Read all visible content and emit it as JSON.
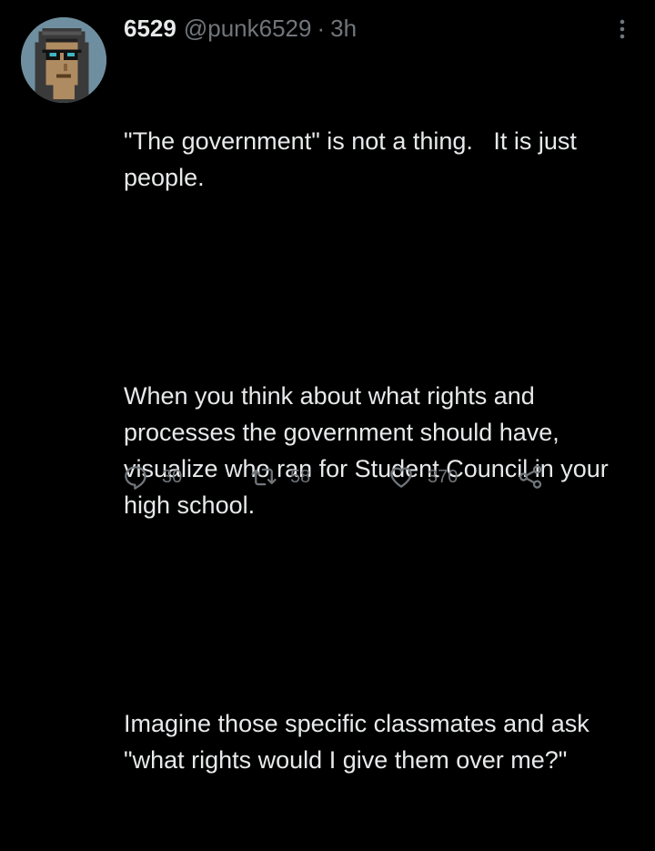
{
  "author": {
    "display_name": "6529",
    "handle": "@punk6529",
    "separator": "·",
    "timestamp": "3h"
  },
  "tweet": {
    "paragraphs": [
      "\"The government\" is not a thing.   It is just people.",
      "When you think about what rights and processes the government should have, visualize who ran for Student Council in your high school.",
      "Imagine those specific classmates and ask \"what rights would I give them over me?\""
    ]
  },
  "actions": {
    "reply_count": "30",
    "retweet_count": "58",
    "like_count": "370"
  },
  "icons": {
    "avatar": "cryptopunk-avatar",
    "more": "more-vertical-icon",
    "reply": "reply-icon",
    "retweet": "retweet-icon",
    "like": "heart-icon",
    "share": "share-icon"
  },
  "colors": {
    "background": "#000000",
    "text": "#e7e9ea",
    "secondary": "#71767b"
  }
}
